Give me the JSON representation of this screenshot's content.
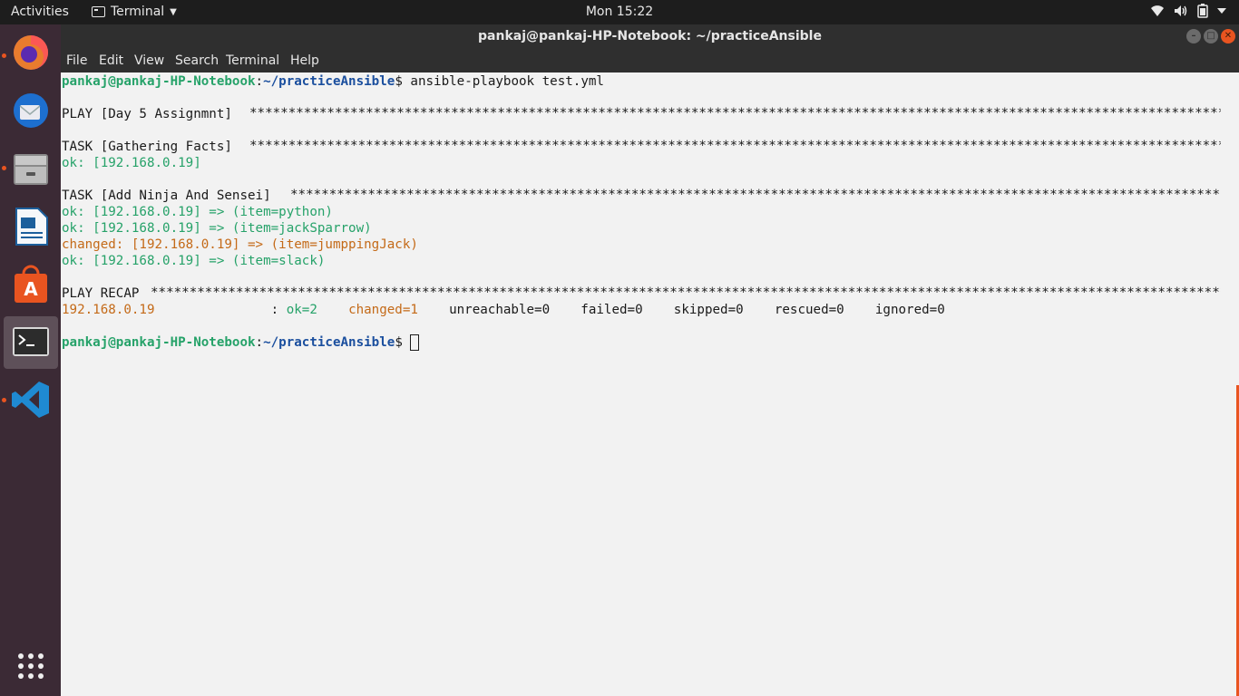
{
  "topbar": {
    "activities": "Activities",
    "app_name": "Terminal",
    "clock": "Mon 15:22",
    "tray_icons": [
      "wifi-icon",
      "volume-icon",
      "battery-icon",
      "chevron-down-icon"
    ]
  },
  "dock": {
    "items": [
      "firefox-icon",
      "thunderbird-icon",
      "files-icon",
      "libreoffice-writer-icon",
      "software-center-icon",
      "terminal-icon",
      "vscode-icon"
    ],
    "show_apps_icon": "grid-icon",
    "accent": "#e95420"
  },
  "window": {
    "title": "pankaj@pankaj-HP-Notebook: ~/practiceAnsible",
    "menu": [
      "File",
      "Edit",
      "View",
      "Search",
      "Terminal",
      "Help"
    ]
  },
  "terminal": {
    "prompt_user": "pankaj@pankaj-HP-Notebook",
    "prompt_path": "~/practiceAnsible",
    "command": " ansible-playbook test.yml",
    "play_header": "PLAY [Day 5 Assignmnt] ",
    "task1_header": "TASK [Gathering Facts] ",
    "task1_result": "ok: [192.168.0.19]",
    "task2_header": "TASK [Add Ninja And Sensei] ",
    "task2_results": [
      "ok: [192.168.0.19] => (item=python)",
      "ok: [192.168.0.19] => (item=jackSparrow)",
      "changed: [192.168.0.19] => (item=jumppingJack)",
      "ok: [192.168.0.19] => (item=slack)"
    ],
    "recap_header": "PLAY RECAP ",
    "recap": {
      "host": "192.168.0.19",
      "sep": "               : ",
      "ok": "ok=2",
      "changed": "changed=1",
      "rest": "    unreachable=0    failed=0    skipped=0    rescued=0    ignored=0"
    },
    "stars": "**************************************************************************************************************************************************************",
    "colors": {
      "ok": "#26a269",
      "changed": "#c46a18",
      "prompt_user": "#26a269",
      "prompt_path": "#1b4f9e"
    }
  }
}
